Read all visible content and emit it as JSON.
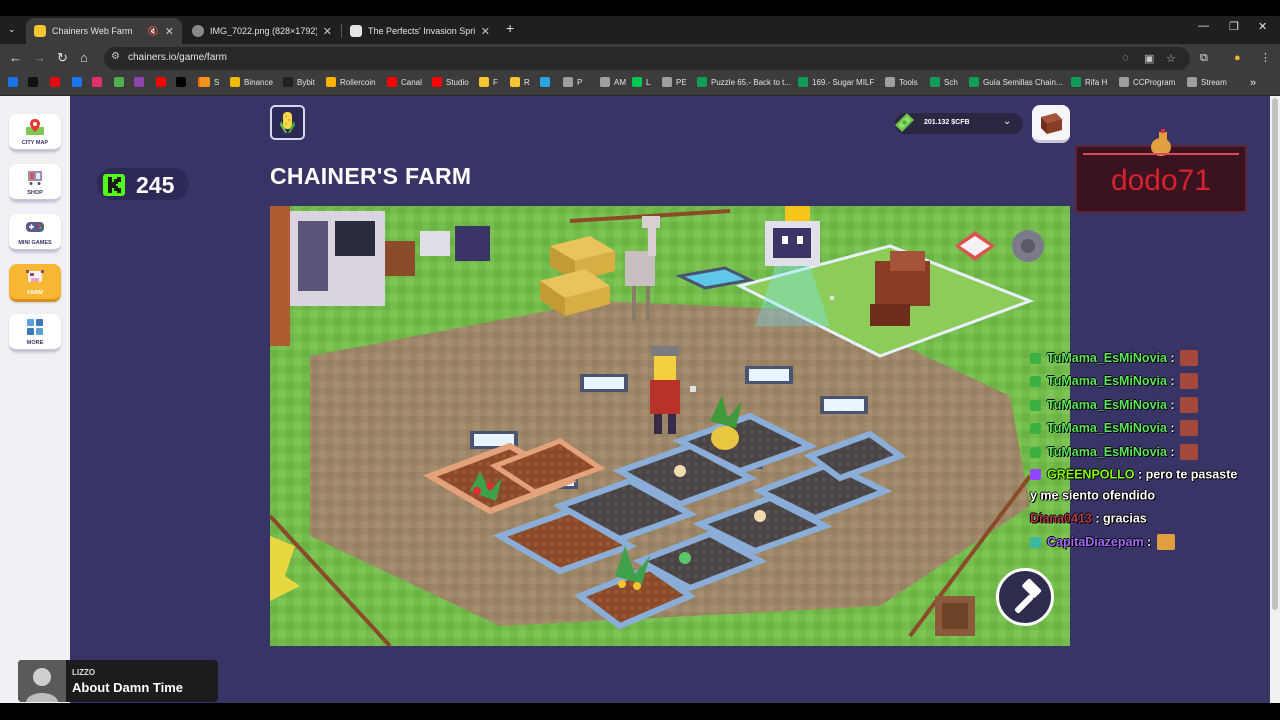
{
  "browser": {
    "tabs": [
      {
        "title": "Chainers Web Farm",
        "favicon_color": "#f7c531"
      },
      {
        "title": "IMG_7022.png (828×1792)",
        "favicon_color": "#8a8a8a"
      },
      {
        "title": "The Perfects' Invasion Sprint #",
        "favicon_color": "#e3e3e3"
      }
    ],
    "new_tab": "+",
    "url": "chainers.io/game/farm",
    "bookmarks": [
      {
        "label": "",
        "color": "#1a73e8"
      },
      {
        "label": "",
        "color": "#111111"
      },
      {
        "label": "",
        "color": "#e50914"
      },
      {
        "label": "",
        "color": "#1877f2"
      },
      {
        "label": "",
        "color": "#e1306c"
      },
      {
        "label": "",
        "color": "#4caf50"
      },
      {
        "label": "",
        "color": "#ff0000"
      },
      {
        "label": "",
        "color": "#8e44ad"
      },
      {
        "label": "",
        "color": "#000000"
      },
      {
        "label": "",
        "color": "#ff6a00"
      },
      {
        "label": "S",
        "color": "#f7931a"
      },
      {
        "label": "Binance",
        "color": "#f0b90b"
      },
      {
        "label": "Bybit",
        "color": "#222222"
      },
      {
        "label": "Rollercoin",
        "color": "#ffb300"
      },
      {
        "label": "Canal",
        "color": "#ff0000"
      },
      {
        "label": "Studio",
        "color": "#ff0000"
      },
      {
        "label": "F",
        "color": "#f7c531"
      },
      {
        "label": "R",
        "color": "#f7c531"
      },
      {
        "label": "",
        "color": "#2aa3e0"
      },
      {
        "label": "P",
        "color": "#9e9e9e"
      },
      {
        "label": "AM",
        "color": "#9e9e9e"
      },
      {
        "label": "L",
        "color": "#00c853"
      },
      {
        "label": "PE",
        "color": "#9e9e9e"
      },
      {
        "label": "Puzzle 65.- Back to t...",
        "color": "#0f9d58"
      },
      {
        "label": "169.- Sugar MILF",
        "color": "#0f9d58"
      },
      {
        "label": "Tools",
        "color": "#9e9e9e"
      },
      {
        "label": "Sch",
        "color": "#0f9d58"
      },
      {
        "label": "Guía Semillas Chain...",
        "color": "#0f9d58"
      },
      {
        "label": "Rifa H",
        "color": "#0f9d58"
      },
      {
        "label": "CCProgram",
        "color": "#9e9e9e"
      },
      {
        "label": "Stream",
        "color": "#9e9e9e"
      }
    ],
    "overflow": "»"
  },
  "sidebar": {
    "items": [
      {
        "label": "CITY MAP",
        "icon": "map-pin-icon",
        "active": false
      },
      {
        "label": "SHOP",
        "icon": "shop-cart-icon",
        "active": false
      },
      {
        "label": "MINI GAMES",
        "icon": "gamepad-icon",
        "active": false
      },
      {
        "label": "FARM",
        "icon": "cow-icon",
        "active": true
      },
      {
        "label": "MORE",
        "icon": "grid-icon",
        "active": false
      }
    ]
  },
  "header": {
    "k_score": "245",
    "title": "CHAINER'S FARM",
    "wallet": "201.132 $CFB"
  },
  "overlay": {
    "streamer": "dodo71",
    "chat": [
      {
        "user": "TuMama_EsMiNovia",
        "color": "#5ce65c",
        "badge": "#3cb043",
        "message": "",
        "emote": true
      },
      {
        "user": "TuMama_EsMiNovia",
        "color": "#5ce65c",
        "badge": "#3cb043",
        "message": "",
        "emote": true
      },
      {
        "user": "TuMama_EsMiNovia",
        "color": "#5ce65c",
        "badge": "#3cb043",
        "message": "",
        "emote": true
      },
      {
        "user": "TuMama_EsMiNovia",
        "color": "#5ce65c",
        "badge": "#3cb043",
        "message": "",
        "emote": true
      },
      {
        "user": "TuMama_EsMiNovia",
        "color": "#5ce65c",
        "badge": "#3cb043",
        "message": "",
        "emote": true
      },
      {
        "user": "GREENPOLLO",
        "color": "#7fff00",
        "badge": "#9146ff",
        "message": "pero te pasaste",
        "emote": false
      },
      {
        "user": "",
        "color": "#ffffff",
        "badge": "",
        "message": "y me siento ofendido",
        "emote": false
      },
      {
        "user": "Diana0413",
        "color": "#b83a48",
        "badge": "",
        "message": "gracias",
        "emote": false
      },
      {
        "user": "CapitaDiazepam",
        "color": "#a36bff",
        "badge": "#3cb8a0",
        "message": "",
        "emote": true
      }
    ]
  },
  "music": {
    "artist": "LIZZO",
    "song": "About Damn Time"
  }
}
